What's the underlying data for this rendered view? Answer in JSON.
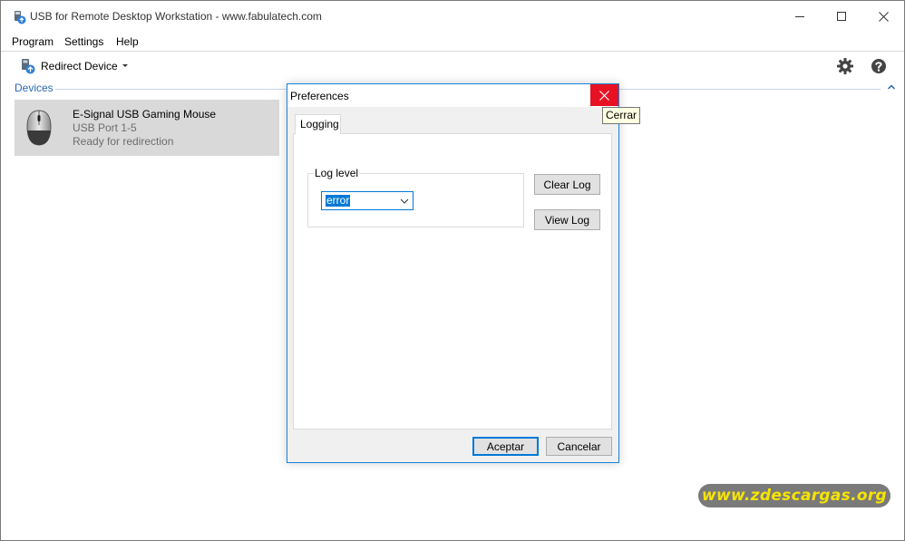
{
  "window": {
    "title": "USB for Remote Desktop Workstation - www.fabulatech.com",
    "icon": "usb-app-icon"
  },
  "menu": {
    "items": [
      "Program",
      "Settings",
      "Help"
    ]
  },
  "toolbar": {
    "redirect_label": "Redirect Device",
    "redirect_icon": "usb-redirect-icon",
    "settings_icon": "gear-icon",
    "help_icon": "help-icon"
  },
  "devices": {
    "header": "Devices",
    "items": [
      {
        "name": "E-Signal USB Gaming Mouse",
        "port": "USB Port   1-5",
        "status": "Ready for redirection",
        "icon": "mouse-icon"
      }
    ]
  },
  "dialog": {
    "title": "Preferences",
    "tab": "Logging",
    "log_level_label": "Log level",
    "log_level_value": "error",
    "clear_log": "Clear Log",
    "view_log": "View Log",
    "accept": "Aceptar",
    "cancel": "Cancelar",
    "close_tooltip": "Cerrar"
  },
  "watermark": {
    "text": "www.zdescargas.org"
  },
  "colors": {
    "accent": "#0078d7",
    "close_red": "#e81123",
    "devices_header": "#2a68b4",
    "watermark_text": "#f6e400"
  }
}
